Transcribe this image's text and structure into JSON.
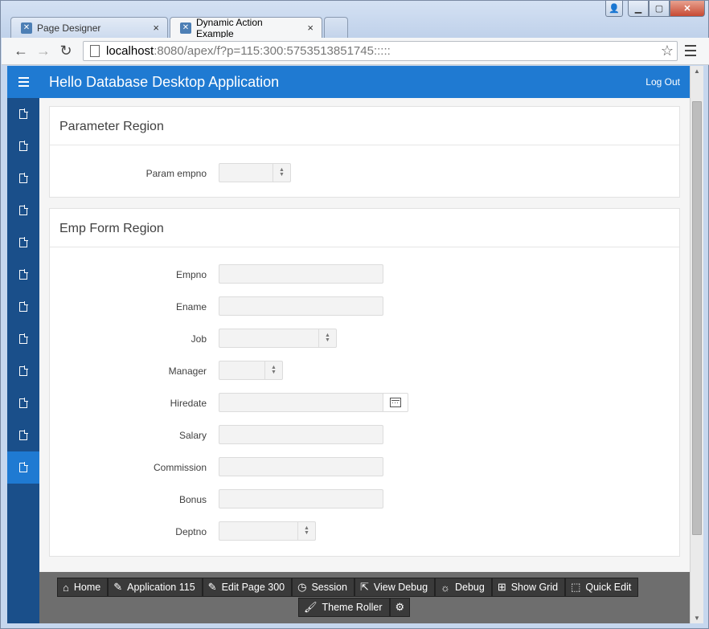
{
  "browser": {
    "tabs": [
      {
        "label": "Page Designer",
        "active": false
      },
      {
        "label": "Dynamic Action Example",
        "active": true
      }
    ],
    "url_host": "localhost",
    "url_rest": ":8080/apex/f?p=115:300:5753513851745:::::"
  },
  "app": {
    "title": "Hello Database Desktop Application",
    "logout_label": "Log Out",
    "accent_color": "#1f7ad2",
    "sidenav_color": "#1a4f8a"
  },
  "sidenav": {
    "item_count": 12,
    "active_index": 11
  },
  "regions": {
    "parameter": {
      "title": "Parameter Region",
      "param_label": "Param empno"
    },
    "emp_form": {
      "title": "Emp Form Region",
      "labels": {
        "empno": "Empno",
        "ename": "Ename",
        "job": "Job",
        "manager": "Manager",
        "hiredate": "Hiredate",
        "salary": "Salary",
        "commission": "Commission",
        "bonus": "Bonus",
        "deptno": "Deptno"
      }
    }
  },
  "devbar": {
    "home": "Home",
    "application": "Application 115",
    "edit_page": "Edit Page 300",
    "session": "Session",
    "view_debug": "View Debug",
    "debug": "Debug",
    "show_grid": "Show Grid",
    "quick_edit": "Quick Edit",
    "theme_roller": "Theme Roller"
  }
}
